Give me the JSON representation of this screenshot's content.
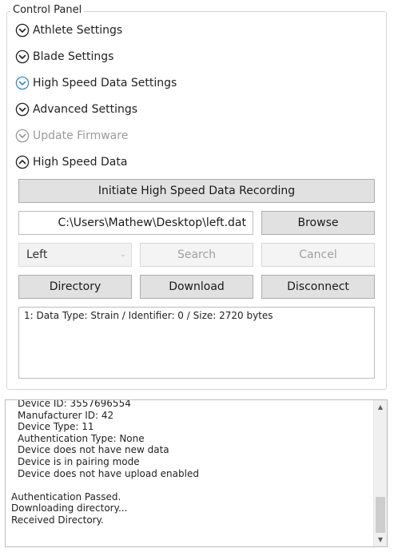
{
  "panel": {
    "title": "Control Panel",
    "sections": [
      {
        "label": "Athlete Settings",
        "state": "collapsed",
        "enabled": true
      },
      {
        "label": "Blade Settings",
        "state": "collapsed",
        "enabled": true
      },
      {
        "label": "High Speed Data Settings",
        "state": "collapsed",
        "enabled": true,
        "hover": true
      },
      {
        "label": "Advanced Settings",
        "state": "collapsed",
        "enabled": true
      },
      {
        "label": "Update Firmware",
        "state": "collapsed",
        "enabled": false
      },
      {
        "label": "High Speed Data",
        "state": "expanded",
        "enabled": true
      }
    ]
  },
  "high_speed_data": {
    "initiate_button": "Initiate High Speed Data Recording",
    "file_path": "C:\\Users\\Mathew\\Desktop\\left.dat",
    "browse_button": "Browse",
    "side_select": {
      "selected": "Left"
    },
    "search_button": "Search",
    "cancel_button": "Cancel",
    "directory_button": "Directory",
    "download_button": "Download",
    "disconnect_button": "Disconnect",
    "entries": [
      "1: Data Type: Strain / Identifier: 0 / Size: 2720 bytes"
    ]
  },
  "log": {
    "lines": [
      {
        "text": "Device ID: 3557696554",
        "indent": true
      },
      {
        "text": "Manufacturer ID: 42",
        "indent": true
      },
      {
        "text": "Device Type: 11",
        "indent": true
      },
      {
        "text": "Authentication Type: None",
        "indent": true
      },
      {
        "text": "Device does not have new data",
        "indent": true
      },
      {
        "text": "Device is in pairing mode",
        "indent": true
      },
      {
        "text": "Device does not have upload enabled",
        "indent": true
      },
      {
        "text": "",
        "indent": false
      },
      {
        "text": "Authentication Passed.",
        "indent": false
      },
      {
        "text": "Downloading directory...",
        "indent": false
      },
      {
        "text": "Received Directory.",
        "indent": false
      }
    ]
  },
  "icons": {
    "collapsed": "chevron-down-circle-icon",
    "expanded": "chevron-up-circle-icon",
    "scroll_up": "scroll-up-arrow-icon",
    "scroll_down": "scroll-down-arrow-icon"
  },
  "colors": {
    "hover_accent": "#3b8ad8",
    "disabled_text": "#9a9a9a",
    "button_face": "#e1e1e1"
  }
}
